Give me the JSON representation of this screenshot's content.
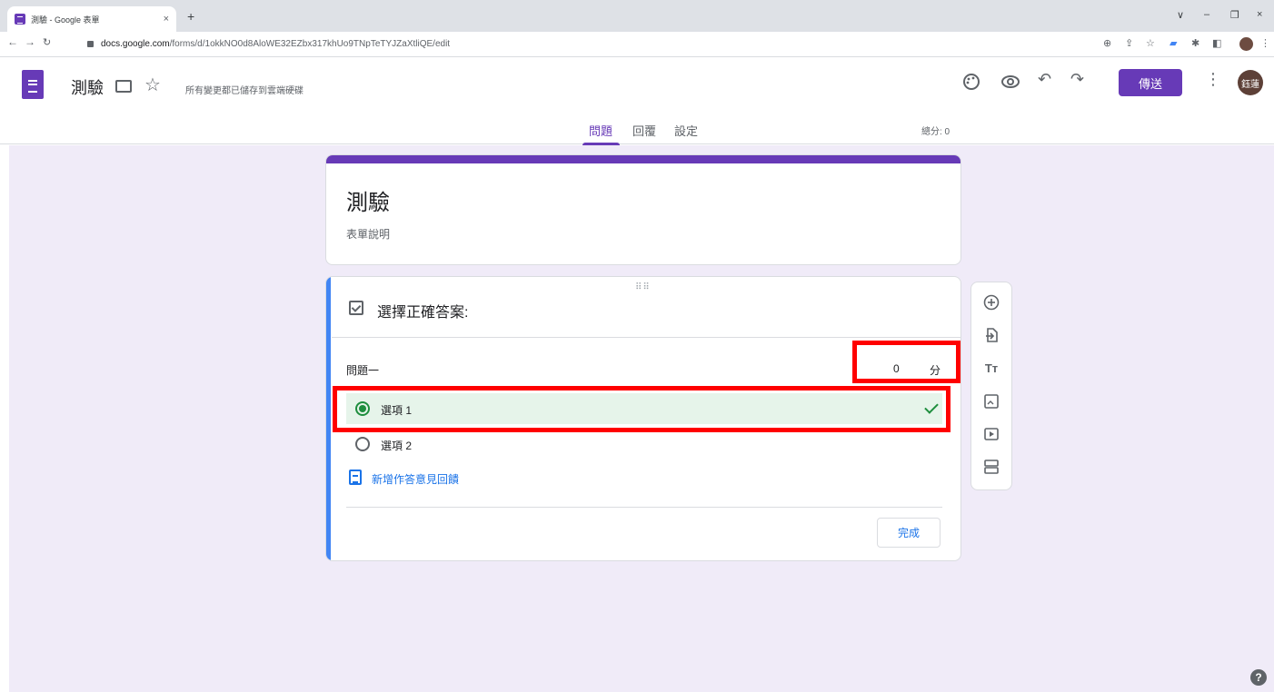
{
  "browser": {
    "tab_title": "測驗 - Google 表單",
    "tab_close": "×",
    "new_tab": "+",
    "url_host": "docs.google.com",
    "url_path": "/forms/d/1okkNO0d8AloWE32EZbx317khUo9TNpTeTYJZaXtliQE/edit",
    "window_controls": [
      "∨",
      "–",
      "❐",
      "×"
    ]
  },
  "header": {
    "doc_title": "測驗",
    "saved_status": "所有變更都已儲存到雲端硬碟",
    "send_label": "傳送",
    "avatar_text": "鈺蓮",
    "more_icon": "⋮"
  },
  "tabs": [
    "問題",
    "回覆",
    "設定"
  ],
  "total_points": "總分: 0",
  "form": {
    "title": "測驗",
    "description": "表單說明"
  },
  "answer_key": {
    "header": "選擇正確答案:",
    "question": "問題一",
    "points_value": "0",
    "points_unit": "分",
    "options": [
      {
        "label": "選項 1",
        "correct": true
      },
      {
        "label": "選項 2",
        "correct": false
      }
    ],
    "feedback_link": "新增作答意見回饋",
    "done_label": "完成",
    "drag_handle": "⠿⠿"
  },
  "toolbar_icons": [
    "add-question-icon",
    "import-questions-icon",
    "add-title-icon",
    "add-image-icon",
    "add-video-icon",
    "add-section-icon"
  ],
  "help_label": "?",
  "colors": {
    "accent": "#673ab7",
    "canvas": "#f0ebf8",
    "correct": "#1e8e3e",
    "correct_bg": "#e6f4ea",
    "link": "#1a73e8",
    "highlight": "#ff0000"
  }
}
